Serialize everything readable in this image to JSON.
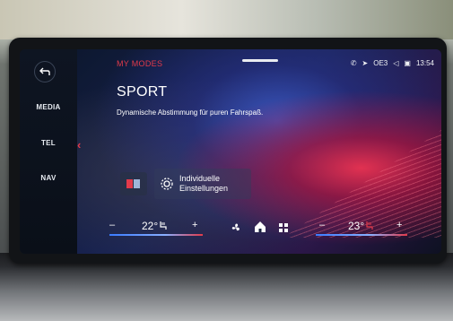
{
  "left_rail": {
    "items": [
      "MEDIA",
      "TEL",
      "NAV"
    ]
  },
  "header": {
    "title": "MY MODES",
    "status": {
      "signal_label": "OE3",
      "time": "13:54"
    }
  },
  "mode": {
    "name": "SPORT",
    "description": "Dynamische Abstimmung für puren Fahrspaß."
  },
  "settings": {
    "line1": "Individuelle",
    "line2": "Einstellungen"
  },
  "climate": {
    "left": {
      "minus": "–",
      "temp": "22°",
      "plus": "+"
    },
    "right": {
      "minus": "–",
      "temp": "23°",
      "plus": "+"
    }
  },
  "colors": {
    "accent": "#e23a4a",
    "text": "#ffffff",
    "temp_cool": "#3a7bff",
    "temp_warm": "#e23a4a"
  }
}
